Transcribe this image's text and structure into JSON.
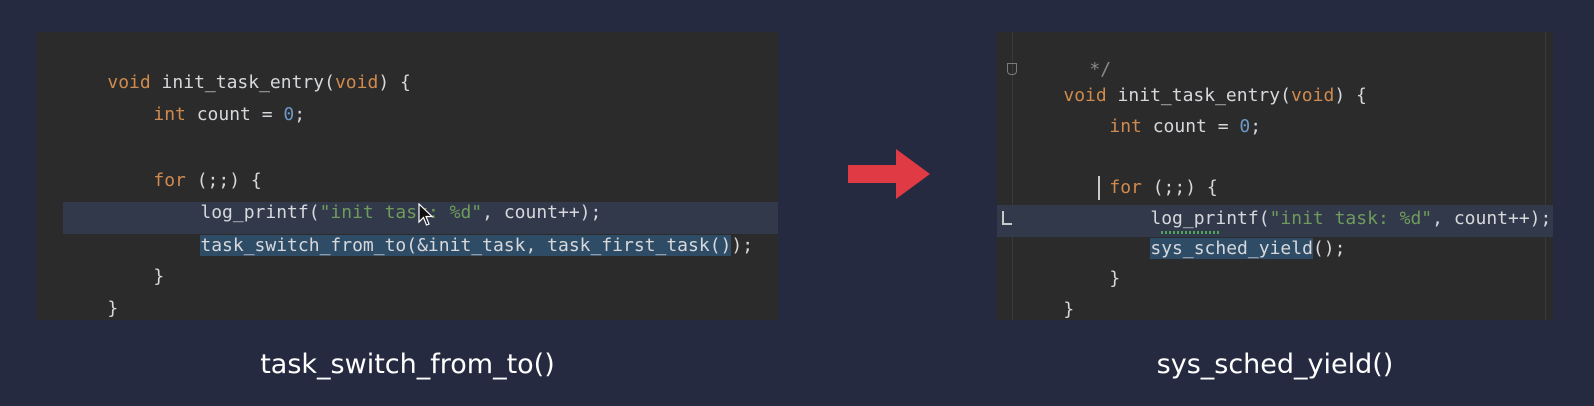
{
  "left": {
    "caption": "task_switch_from_to()",
    "code": {
      "l1_kw": "void",
      "l1_a": " init_task_entry(",
      "l1_kw2": "void",
      "l1_b": ") {",
      "l2_kw": "int",
      "l2_a": " count = ",
      "l2_num": "0",
      "l2_b": ";",
      "l4_kw": "for",
      "l4_a": " (;;) {",
      "l5_a": "log_printf(",
      "l5_str": "\"init task: %d\"",
      "l5_b": ", count++);",
      "l6_sel": "task_switch_from_to(&init_task, task_first_task()",
      "l6_b": ");",
      "l7": "}",
      "l8": "}"
    }
  },
  "right": {
    "caption": "sys_sched_yield()",
    "code": {
      "l0": "*/",
      "l1_kw": "void",
      "l1_a": " init_task_entry(",
      "l1_kw2": "void",
      "l1_b": ") {",
      "l2_kw": "int",
      "l2_a": " count = ",
      "l2_num": "0",
      "l2_b": ";",
      "l4_kw": "for",
      "l4_a": " (;;) {",
      "l5_a": "log_printf(",
      "l5_str": "\"init task: %d\"",
      "l5_b": ", count++);",
      "l6_sel": "sys_sched_yield",
      "l6_b": "();",
      "l7": "}",
      "l8": "}"
    },
    "gutter_icon": "breakpoint-marker-icon"
  },
  "arrow_icon": "right-arrow-icon",
  "cursor_icon": "mouse-pointer-icon",
  "colors": {
    "background": "#262a40",
    "editor_bg": "#2b2b2b",
    "keyword": "#d08a4d",
    "number": "#6c98c5",
    "string": "#6f9b5c",
    "selection": "#2f4c66",
    "arrow": "#e03a45"
  }
}
